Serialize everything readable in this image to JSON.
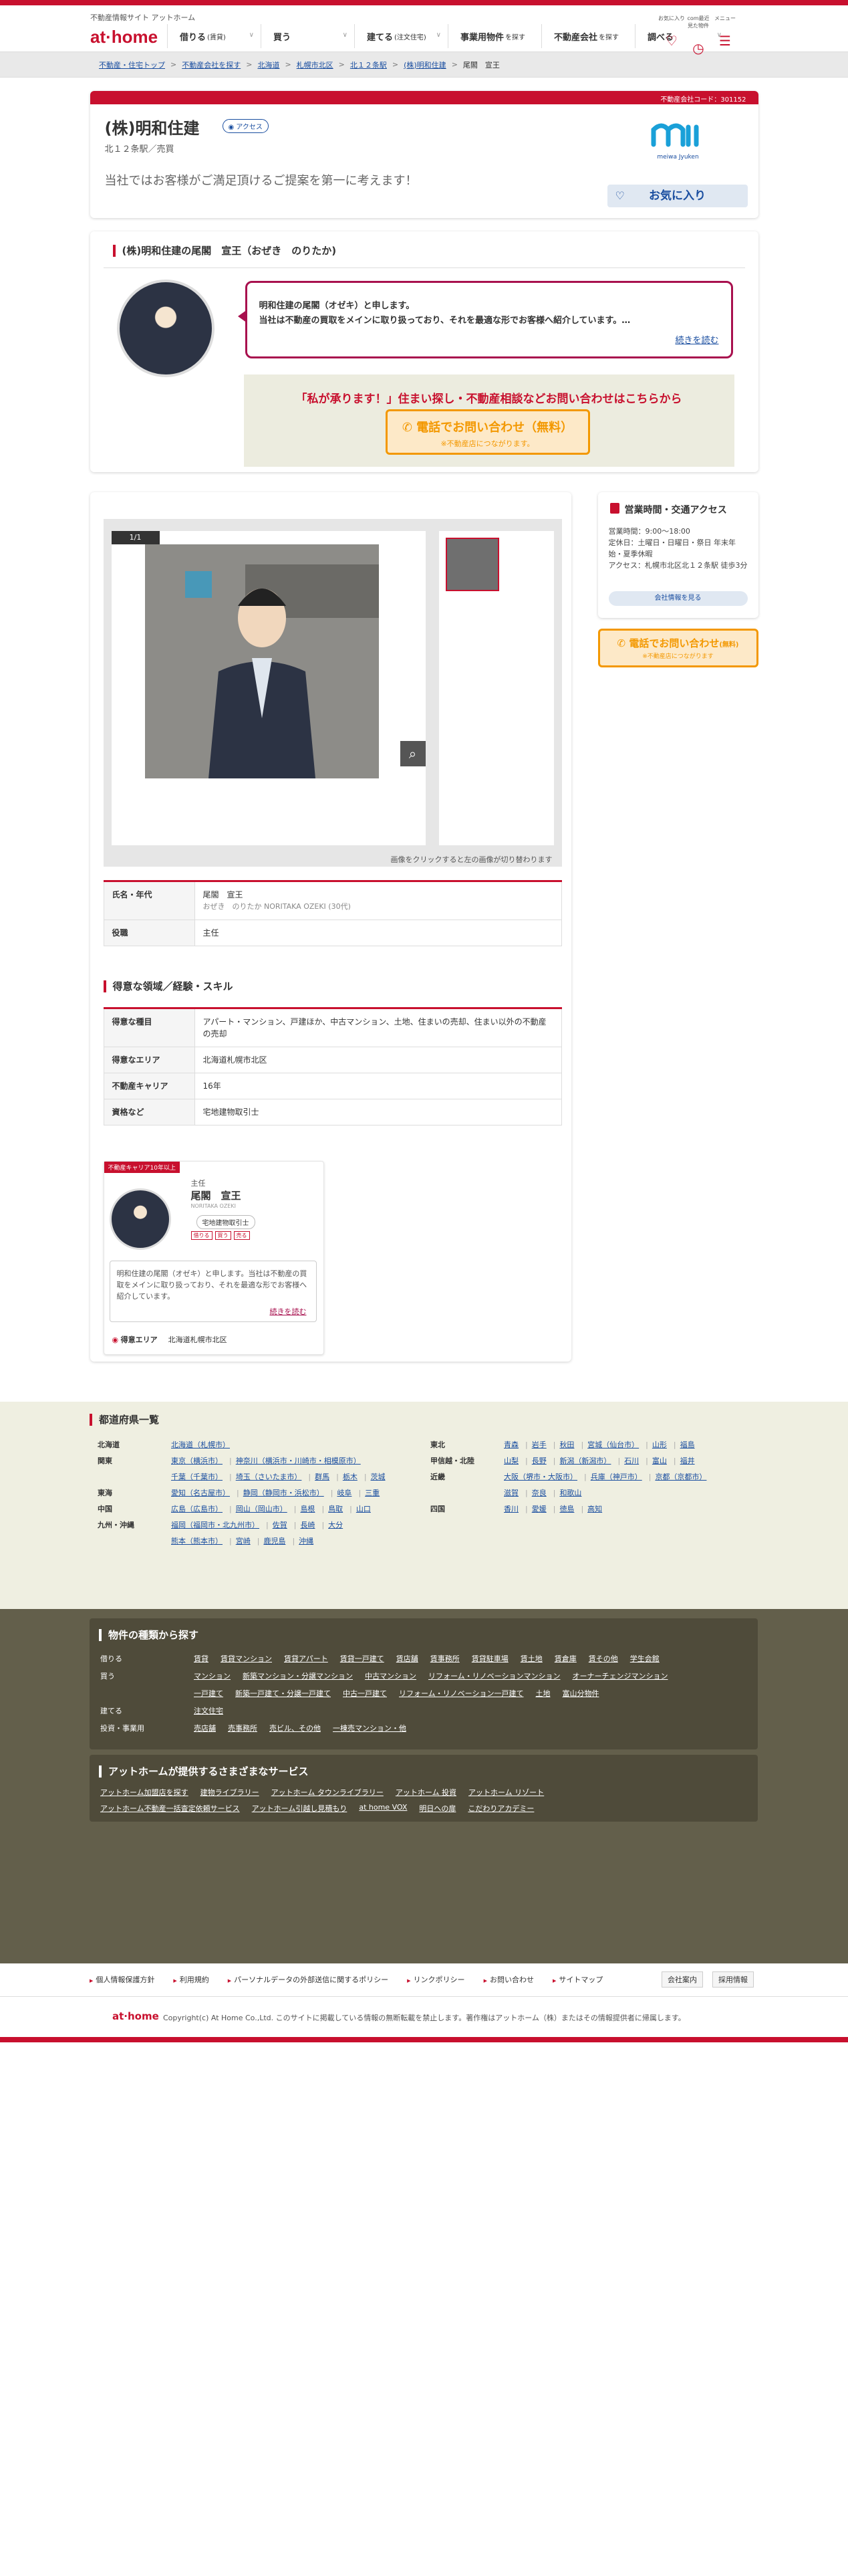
{
  "header": {
    "tagline": "不動産情報サイト アットホーム",
    "logo": "at·home",
    "nav": [
      {
        "label": "借りる",
        "sub": "(賃貸)"
      },
      {
        "label": "買う",
        "sub": ""
      },
      {
        "label": "建てる",
        "sub": "(注文住宅)"
      },
      {
        "label": "事業用物件",
        "sub": "を探す"
      },
      {
        "label": "不動産会社",
        "sub": "を探す"
      },
      {
        "label": "調べる",
        "sub": ""
      }
    ],
    "util": [
      "お気に入り",
      "com最近見た物件",
      "メニュー"
    ]
  },
  "breadcrumb": [
    "不動産・住宅トップ",
    "不動産会社を探す",
    "北海道",
    "札幌市北区",
    "北１２条駅",
    "(株)明和住建",
    "尾閣　宣王"
  ],
  "company": {
    "code": "不動産会社コード：301152",
    "name": "(株)明和住建",
    "access_label": "アクセス",
    "addr": "北１２条駅／売買",
    "catch": "当社ではお客様がご満足頂けるご提案を第一に考えます！",
    "logo_text": "meiwa Jyuken",
    "fav": "お気に入り"
  },
  "staff": {
    "title": "(株)明和住建の尾閣　宣王（おぜき　のりたか)",
    "message": [
      "明和住建の尾閣（オゼキ）と申します。",
      "当社は不動産の買取をメインに取り扱っており、それを最適な形でお客様へ紹介しています。…"
    ],
    "more": "続きを読む",
    "cta_title": "「私が承ります！」住まい探し・不動産相談などお問い合わせはこちらから",
    "cta_btn": "電話でお問い合わせ（無料）",
    "cta_sub": "※不動産店につながります。"
  },
  "gallery": {
    "counter": "1/1",
    "note": "画像をクリックすると左の画像が切り替わります"
  },
  "profile": [
    {
      "k": "氏名・年代",
      "v": "尾閣　宣王",
      "sub": "おぜき　のりたか NORITAKA OZEKI (30代)"
    },
    {
      "k": "役職",
      "v": "主任"
    }
  ],
  "skills_title": "得意な領域／経験・スキル",
  "skills": [
    {
      "k": "得意な種目",
      "v": "アパート・マンション、戸建ほか、中古マンション、土地、住まいの売却、住まい以外の不動産の売却"
    },
    {
      "k": "得意なエリア",
      "v": "北海道札幌市北区"
    },
    {
      "k": "不動産キャリア",
      "v": "16年"
    },
    {
      "k": "資格など",
      "v": "宅地建物取引士"
    }
  ],
  "mini": {
    "tag": "不動産キャリア10年以上",
    "role": "主任",
    "name": "尾閣　宣王",
    "roman": "NORITAKA OZEKI",
    "license": "宅地建物取引士",
    "tags": [
      "借りる",
      "買う",
      "売る"
    ],
    "msg": "明和住建の尾閣（オゼキ）と申します。当社は不動産の買取をメインに取り扱っており、それを最適な形でお客様へ紹介しています。",
    "more": "続きを読む",
    "area_label": "得意エリア",
    "area": "北海道札幌市北区"
  },
  "side": {
    "hours_title": "営業時間・交通アクセス",
    "hours": [
      "営業時間：9:00〜18:00",
      "定休日：土曜日・日曜日・祭日 年末年始・夏季休暇",
      "アクセス：札幌市北区北１２条駅 徒歩3分"
    ],
    "link": "会社情報を見る",
    "cta": "電話でお問い合わせ",
    "cta_free": "(無料)",
    "cta_sub": "※不動産店につながります"
  },
  "pref": {
    "title": "都道府県一覧",
    "left": [
      {
        "k": "北海道",
        "v": [
          "北海道（札幌市）"
        ]
      },
      {
        "k": "関東",
        "v": [
          "東京（横浜市）",
          "神奈川（横浜市・川崎市・相模原市）"
        ]
      },
      {
        "k": "",
        "v": [
          "千葉（千葉市）",
          "埼玉（さいたま市）",
          "群馬",
          "栃木",
          "茨城"
        ]
      },
      {
        "k": "東海",
        "v": [
          "愛知（名古屋市）",
          "静岡（静岡市・浜松市）",
          "岐阜",
          "三重"
        ]
      },
      {
        "k": "中国",
        "v": [
          "広島（広島市）",
          "岡山（岡山市）",
          "島根",
          "鳥取",
          "山口"
        ]
      },
      {
        "k": "九州・沖縄",
        "v": [
          "福岡（福岡市・北九州市）",
          "佐賀",
          "長崎",
          "大分"
        ]
      },
      {
        "k": "",
        "v": [
          "熊本（熊本市）",
          "宮崎",
          "鹿児島",
          "沖縄"
        ]
      }
    ],
    "right": [
      {
        "k": "東北",
        "v": [
          "青森",
          "岩手",
          "秋田",
          "宮城（仙台市）",
          "山形",
          "福島"
        ]
      },
      {
        "k": "甲信越・北陸",
        "v": [
          "山梨",
          "長野",
          "新潟（新潟市）",
          "石川",
          "富山",
          "福井"
        ]
      },
      {
        "k": "近畿",
        "v": [
          "大阪（堺市・大阪市）",
          "兵庫（神戸市）",
          "京都（京都市）"
        ]
      },
      {
        "k": "",
        "v": [
          "滋賀",
          "奈良",
          "和歌山"
        ]
      },
      {
        "k": "四国",
        "v": [
          "香川",
          "愛媛",
          "徳島",
          "高知"
        ]
      }
    ]
  },
  "types": {
    "title": "物件の種類から探す",
    "rows": [
      {
        "k": "借りる",
        "v": [
          "賃貸",
          "賃貸マンション",
          "賃貸アパート",
          "賃貸一戸建て",
          "賃店舗",
          "賃事務所",
          "賃貸駐車場",
          "賃土地",
          "賃倉庫",
          "賃その他",
          "学生会館"
        ]
      },
      {
        "k": "買う",
        "v": [
          "マンション",
          "新築マンション・分譲マンション",
          "中古マンション",
          "リフォーム・リノベーションマンション",
          "オーナーチェンジマンション"
        ]
      },
      {
        "k": "",
        "v": [
          "一戸建て",
          "新築一戸建て・分譲一戸建て",
          "中古一戸建て",
          "リフォーム・リノベーション一戸建て",
          "土地",
          "富山分物件"
        ]
      },
      {
        "k": "建てる",
        "v": [
          "注文住宅"
        ]
      },
      {
        "k": "投資・事業用",
        "v": [
          "売店舗",
          "売事務所",
          "売ビル、その他",
          "一棟売マンション・他"
        ]
      }
    ],
    "services_title": "アットホームが提供するさまざまなサービス",
    "services": [
      [
        "アットホーム加盟店を探す",
        "建物ライブラリー",
        "アットホーム タウンライブラリー",
        "アットホーム 投資",
        "アットホーム リゾート"
      ],
      [
        "アットホーム不動産一括査定依頼サービス",
        "アットホーム引越し見積もり",
        "at home VOX",
        "明日への扉",
        "こだわりアカデミー"
      ]
    ]
  },
  "footer": {
    "links": [
      "個人情報保護方針",
      "利用規約",
      "パーソナルデータの外部送信に関するポリシー",
      "リンクポリシー",
      "お問い合わせ",
      "サイトマップ"
    ],
    "company_link": "会社案内",
    "recruit": "採用情報",
    "logo": "at·home",
    "copy": "Copyright(c) At Home Co.,Ltd. このサイトに掲載している情報の無断転載を禁止します。著作権はアットホーム（株）またはその情報提供者に帰属します。"
  }
}
